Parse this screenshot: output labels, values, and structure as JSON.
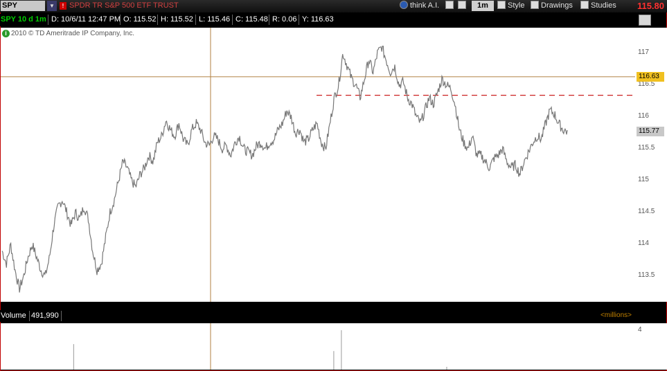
{
  "toolbar": {
    "symbol": "SPY",
    "alert_badge": "!",
    "description": "SPDR TR S&P 500 ETF TRUST",
    "think_ai_label": "think A.I.",
    "timeframe_label": "1m",
    "style_label": "Style",
    "drawings_label": "Drawings",
    "studies_label": "Studies",
    "last_price": "115.80"
  },
  "infobar": {
    "chart_label": "SPY 10 d 1m",
    "date": "D: 10/6/11 12:47 PM",
    "open": "O: 115.52",
    "high": "H: 115.52",
    "low": "L: 115.46",
    "close": "C: 115.48",
    "range": "R: 0.06",
    "y": "Y: 116.63"
  },
  "price_chart": {
    "copyright": "2010 © TD Ameritrade IP Company, Inc.",
    "info_icon": "i"
  },
  "chart_data": {
    "type": "line",
    "ylim": [
      113.1,
      117.4
    ],
    "y_ticks": [
      "117",
      "116.5",
      "116",
      "115.5",
      "115",
      "114.5",
      "114",
      "113.5"
    ],
    "y_tick_values": [
      117,
      116.5,
      116,
      115.5,
      115,
      114.5,
      114,
      113.5
    ],
    "crosshair_price": "116.63",
    "crosshair_price_value": 116.63,
    "current_price": "115.77",
    "current_price_value": 115.77,
    "dashed_level": 116.34,
    "series": [
      {
        "values": [
          113.9,
          113.7,
          114.0,
          113.6,
          113.3,
          113.5,
          113.8,
          114.0,
          113.8,
          113.6,
          113.5,
          113.8,
          114.3,
          114.6,
          114.7,
          114.5,
          114.3,
          114.5,
          114.4,
          114.6,
          114.4,
          113.9,
          113.6,
          113.7,
          114.1,
          114.5,
          114.7,
          115.0,
          115.3,
          115.2,
          115.0,
          114.9,
          115.1,
          115.2,
          115.4,
          115.3,
          115.6,
          115.7,
          115.95,
          115.8,
          115.7,
          115.9,
          115.65,
          115.55,
          115.8,
          115.9,
          115.8,
          115.6,
          115.55,
          115.7,
          115.65,
          115.5,
          115.55,
          115.4,
          115.6,
          115.7,
          115.5,
          115.45,
          115.4,
          115.55,
          115.6,
          115.5,
          115.6,
          115.65,
          115.8,
          115.9,
          116.1,
          116.0,
          115.75,
          115.8,
          115.6,
          115.65,
          115.8,
          115.9,
          115.6,
          115.5,
          115.9,
          116.3,
          116.5,
          117.0,
          116.8,
          116.6,
          116.5,
          116.3,
          116.6,
          116.9,
          116.7,
          117.0,
          117.1,
          116.9,
          116.7,
          116.8,
          116.5,
          116.55,
          116.3,
          116.2,
          116.0,
          115.9,
          116.1,
          116.3,
          116.2,
          116.4,
          116.6,
          116.5,
          116.45,
          116.2,
          115.8,
          115.6,
          115.5,
          115.7,
          115.4,
          115.4,
          115.3,
          115.2,
          115.35,
          115.4,
          115.5,
          115.3,
          115.2,
          115.25,
          115.1,
          115.3,
          115.45,
          115.6,
          115.7,
          115.65,
          115.9,
          116.1,
          116.05,
          115.9,
          115.8,
          115.77
        ]
      }
    ],
    "volume_bars": [
      {
        "x": 0.115,
        "v": 0.55
      },
      {
        "x": 0.525,
        "v": 0.4
      },
      {
        "x": 0.537,
        "v": 0.85
      },
      {
        "x": 0.703,
        "v": 0.06
      }
    ]
  },
  "volume": {
    "label": "Volume",
    "value": "491,990",
    "units": "<millions>",
    "axis_tick": "4"
  },
  "colors": {
    "price_line": "#777777",
    "dashed_line": "#cc2020",
    "crosshair": "#b08040",
    "crosshair_tag": "#f0c020",
    "current_tag": "#c8c8c8",
    "volume_bar": "#999999"
  }
}
